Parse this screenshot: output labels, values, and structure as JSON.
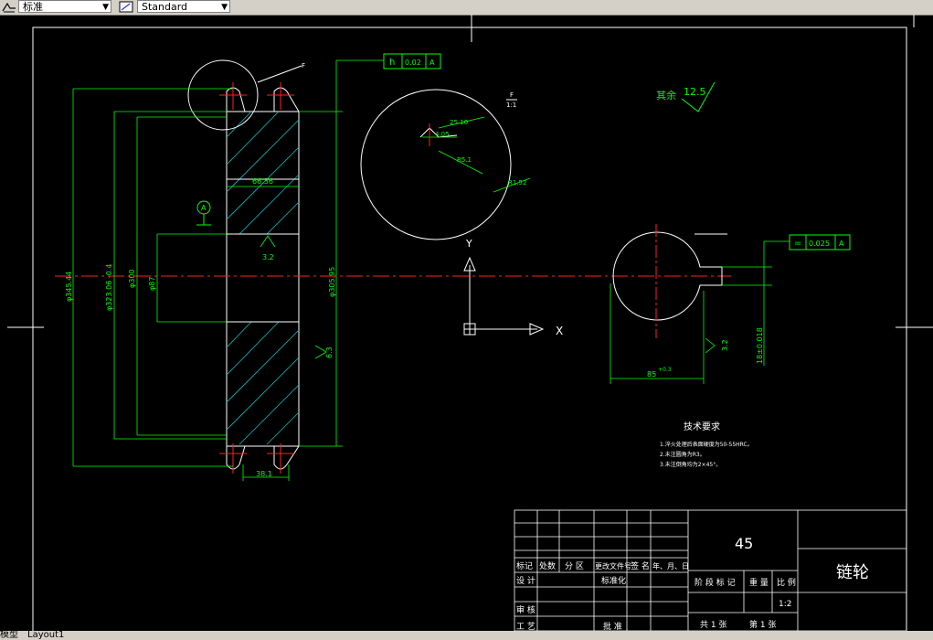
{
  "toolbar": {
    "text_style": "标准",
    "dim_style": "Standard"
  },
  "tabs": {
    "model": "模型",
    "layout": "Layout1"
  },
  "drawing": {
    "gtol_top": "0.02",
    "gtol_top_sym": "h",
    "gtol_top_ref": "A",
    "gtol_right": "0.025",
    "gtol_right_sym": "=",
    "gtol_right_ref": "A",
    "datum": "A",
    "detail_callout": "F",
    "detail_label": "F",
    "detail_scale": "1:1",
    "roughness_rest_label": "其余",
    "roughness_rest_value": "12.5",
    "dims": {
      "d_outer": "φ345.44",
      "d_pitch": "φ323.06 -0.4",
      "d_root": "φ300",
      "d_bore": "φ87",
      "d_right": "φ305.95",
      "width_top": "66.36",
      "width_bottom": "38.1",
      "rough_hub": "3.2",
      "rough_side": "6.3",
      "detail_r1": "25.10",
      "detail_r2": "4.05",
      "detail_r3": "R5.1",
      "detail_r4": "R1.52",
      "key_depth": "85",
      "key_tol": "+0.3",
      "key_width": "18±0.018",
      "key_rough": "3.2"
    },
    "axis_x": "X",
    "axis_y": "Y",
    "tech_title": "技术要求",
    "tech_req": [
      "1.淬火处理后表面硬度为50-55HRC。",
      "2.未注圆角为R3。",
      "3.未注倒角均为2×45°。"
    ]
  },
  "title_block": {
    "material": "45",
    "part_name": "链轮",
    "headers": [
      "标记",
      "处数",
      "分 区",
      "更改文件号",
      "签 名",
      "年、月、日"
    ],
    "row_design": "设 计",
    "row_std": "标准化",
    "row_check": "审 核",
    "row_process": "工 艺",
    "row_approve": "批 准",
    "stage_header": [
      "阶 段 标 记",
      "重 量",
      "比 例"
    ],
    "scale": "1:2",
    "sheets": [
      "共 1  张",
      "第 1 张"
    ]
  }
}
